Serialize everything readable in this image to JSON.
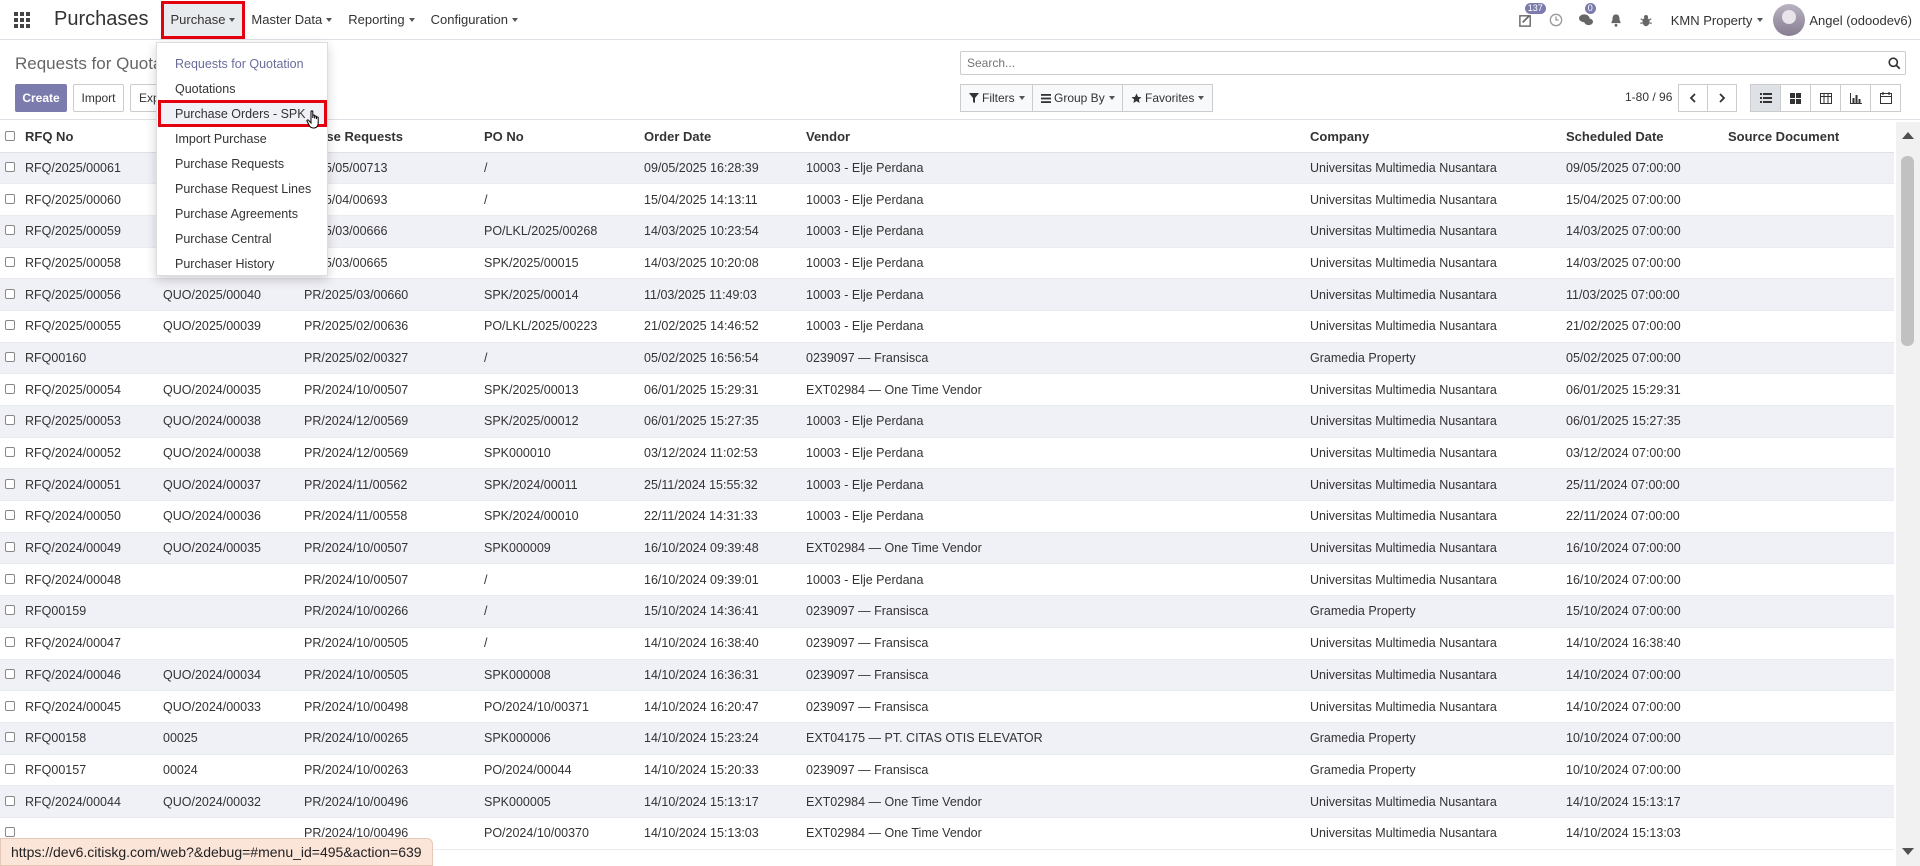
{
  "app": {
    "title": "Purchases"
  },
  "nav": {
    "menus": [
      "Purchase",
      "Master Data",
      "Reporting",
      "Configuration"
    ]
  },
  "systray": {
    "activity_badge": "137",
    "messages_badge": "0",
    "company": "KMN Property",
    "user": "Angel (odoodev6)"
  },
  "control": {
    "title": "Requests for Quota",
    "create_label": "Create",
    "import_label": "Import",
    "export_label": "Exp",
    "search_placeholder": "Search...",
    "filters_label": "Filters",
    "groupby_label": "Group By",
    "favorites_label": "Favorites",
    "pager": "1-80 / 96"
  },
  "dropdown": {
    "items": [
      "Requests for Quotation",
      "Quotations",
      "Purchase Orders - SPK",
      "Import Purchase",
      "Purchase Requests",
      "Purchase Request Lines",
      "Purchase Agreements",
      "Purchase Central",
      "Purchaser History"
    ]
  },
  "table": {
    "columns": [
      "RFQ No",
      "",
      "chase Requests",
      "PO No",
      "Order Date",
      "Vendor",
      "Company",
      "Scheduled Date",
      "Source Document"
    ],
    "rows": [
      [
        "RFQ/2025/00061",
        "",
        "2025/05/00713",
        "/",
        "09/05/2025 16:28:39",
        "10003 - Elje Perdana",
        "Universitas Multimedia Nusantara",
        "09/05/2025 07:00:00",
        ""
      ],
      [
        "RFQ/2025/00060",
        "",
        "2025/04/00693",
        "/",
        "15/04/2025 14:13:11",
        "10003 - Elje Perdana",
        "Universitas Multimedia Nusantara",
        "15/04/2025 07:00:00",
        ""
      ],
      [
        "RFQ/2025/00059",
        "",
        "2025/03/00666",
        "PO/LKL/2025/00268",
        "14/03/2025 10:23:54",
        "10003 - Elje Perdana",
        "Universitas Multimedia Nusantara",
        "14/03/2025 07:00:00",
        ""
      ],
      [
        "RFQ/2025/00058",
        "",
        "2025/03/00665",
        "SPK/2025/00015",
        "14/03/2025 10:20:08",
        "10003 - Elje Perdana",
        "Universitas Multimedia Nusantara",
        "14/03/2025 07:00:00",
        ""
      ],
      [
        "RFQ/2025/00056",
        "QUO/2025/00040",
        "PR/2025/03/00660",
        "SPK/2025/00014",
        "11/03/2025 11:49:03",
        "10003 - Elje Perdana",
        "Universitas Multimedia Nusantara",
        "11/03/2025 07:00:00",
        ""
      ],
      [
        "RFQ/2025/00055",
        "QUO/2025/00039",
        "PR/2025/02/00636",
        "PO/LKL/2025/00223",
        "21/02/2025 14:46:52",
        "10003 - Elje Perdana",
        "Universitas Multimedia Nusantara",
        "21/02/2025 07:00:00",
        ""
      ],
      [
        "RFQ00160",
        "",
        "PR/2025/02/00327",
        "/",
        "05/02/2025 16:56:54",
        "0239097 — Fransisca",
        "Gramedia Property",
        "05/02/2025 07:00:00",
        ""
      ],
      [
        "RFQ/2025/00054",
        "QUO/2024/00035",
        "PR/2024/10/00507",
        "SPK/2025/00013",
        "06/01/2025 15:29:31",
        "EXT02984 — One Time Vendor",
        "Universitas Multimedia Nusantara",
        "06/01/2025 15:29:31",
        ""
      ],
      [
        "RFQ/2025/00053",
        "QUO/2024/00038",
        "PR/2024/12/00569",
        "SPK/2025/00012",
        "06/01/2025 15:27:35",
        "10003 - Elje Perdana",
        "Universitas Multimedia Nusantara",
        "06/01/2025 15:27:35",
        ""
      ],
      [
        "RFQ/2024/00052",
        "QUO/2024/00038",
        "PR/2024/12/00569",
        "SPK000010",
        "03/12/2024 11:02:53",
        "10003 - Elje Perdana",
        "Universitas Multimedia Nusantara",
        "03/12/2024 07:00:00",
        ""
      ],
      [
        "RFQ/2024/00051",
        "QUO/2024/00037",
        "PR/2024/11/00562",
        "SPK/2024/00011",
        "25/11/2024 15:55:32",
        "10003 - Elje Perdana",
        "Universitas Multimedia Nusantara",
        "25/11/2024 07:00:00",
        ""
      ],
      [
        "RFQ/2024/00050",
        "QUO/2024/00036",
        "PR/2024/11/00558",
        "SPK/2024/00010",
        "22/11/2024 14:31:33",
        "10003 - Elje Perdana",
        "Universitas Multimedia Nusantara",
        "22/11/2024 07:00:00",
        ""
      ],
      [
        "RFQ/2024/00049",
        "QUO/2024/00035",
        "PR/2024/10/00507",
        "SPK000009",
        "16/10/2024 09:39:48",
        "EXT02984 — One Time Vendor",
        "Universitas Multimedia Nusantara",
        "16/10/2024 07:00:00",
        ""
      ],
      [
        "RFQ/2024/00048",
        "",
        "PR/2024/10/00507",
        "/",
        "16/10/2024 09:39:01",
        "10003 - Elje Perdana",
        "Universitas Multimedia Nusantara",
        "16/10/2024 07:00:00",
        ""
      ],
      [
        "RFQ00159",
        "",
        "PR/2024/10/00266",
        "/",
        "15/10/2024 14:36:41",
        "0239097 — Fransisca",
        "Gramedia Property",
        "15/10/2024 07:00:00",
        ""
      ],
      [
        "RFQ/2024/00047",
        "",
        "PR/2024/10/00505",
        "/",
        "14/10/2024 16:38:40",
        "0239097 — Fransisca",
        "Universitas Multimedia Nusantara",
        "14/10/2024 16:38:40",
        ""
      ],
      [
        "RFQ/2024/00046",
        "QUO/2024/00034",
        "PR/2024/10/00505",
        "SPK000008",
        "14/10/2024 16:36:31",
        "0239097 — Fransisca",
        "Universitas Multimedia Nusantara",
        "14/10/2024 07:00:00",
        ""
      ],
      [
        "RFQ/2024/00045",
        "QUO/2024/00033",
        "PR/2024/10/00498",
        "PO/2024/10/00371",
        "14/10/2024 16:20:47",
        "0239097 — Fransisca",
        "Universitas Multimedia Nusantara",
        "14/10/2024 07:00:00",
        ""
      ],
      [
        "RFQ00158",
        "00025",
        "PR/2024/10/00265",
        "SPK000006",
        "14/10/2024 15:23:24",
        "EXT04175 — PT. CITAS OTIS ELEVATOR",
        "Gramedia Property",
        "10/10/2024 07:00:00",
        ""
      ],
      [
        "RFQ00157",
        "00024",
        "PR/2024/10/00263",
        "PO/2024/00044",
        "14/10/2024 15:20:33",
        "0239097 — Fransisca",
        "Gramedia Property",
        "10/10/2024 07:00:00",
        ""
      ],
      [
        "RFQ/2024/00044",
        "QUO/2024/00032",
        "PR/2024/10/00496",
        "SPK000005",
        "14/10/2024 15:13:17",
        "EXT02984 — One Time Vendor",
        "Universitas Multimedia Nusantara",
        "14/10/2024 15:13:17",
        ""
      ],
      [
        "",
        "",
        "PR/2024/10/00496",
        "PO/2024/10/00370",
        "14/10/2024 15:13:03",
        "EXT02984 — One Time Vendor",
        "Universitas Multimedia Nusantara",
        "14/10/2024 15:13:03",
        ""
      ]
    ]
  },
  "status_url": "https://dev6.citiskg.com/web?&debug=#menu_id=495&action=639",
  "colors": {
    "primary": "#7c7bad",
    "highlight": "#e3000f",
    "row_alt": "#f0f0f7"
  }
}
